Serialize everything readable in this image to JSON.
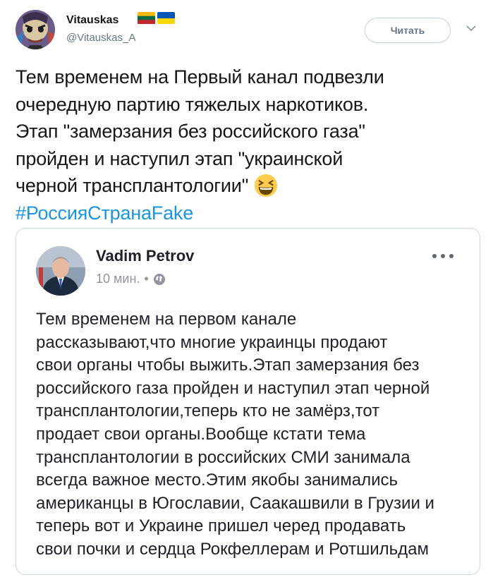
{
  "tweet": {
    "author_name": "Vitauskas",
    "handle": "@Vitauskas_A",
    "follow_label": "Читать",
    "text_lines": [
      "Тем временем на Первый канал подвезли",
      "очередную партию тяжелых наркотиков.",
      "Этап \"замерзания без российского газа\"",
      "пройден и наступил этап \"украинской",
      "черной трансплантологии\""
    ],
    "hashtag": "#РоссияСтранаFake",
    "icons": {
      "avatar": "avatar-image",
      "flags": [
        "lithuania-flag-icon",
        "ukraine-flag-icon"
      ],
      "menu": "chevron-down-icon",
      "emoji": "laughing-face-emoji-icon"
    }
  },
  "embedded_post": {
    "author_name": "Vadim Petrov",
    "time": "10 мин.",
    "dot": "•",
    "text_lines": [
      "Тем временем на первом канале",
      "рассказывают,что многие украинцы продают",
      "свои органы чтобы выжить.Этап замерзания без",
      "российского газа пройден и наступил этап черной",
      "трансплантологии,теперь кто не замёрз,тот",
      "продает свои органы.Вообще кстати тема",
      "трансплантологии в российских СМИ занимала",
      "всегда важное место.Этим якобы занимались",
      "американцы в Югославии, Саакашвили в Грузии и",
      "теперь вот и Украине пришел черед продавать",
      "свои почки и сердца Рокфеллерам и Ротшильдам"
    ],
    "icons": {
      "avatar": "avatar-image",
      "privacy": "globe-icon",
      "more": "more-options-icon"
    }
  },
  "colors": {
    "link": "#1b95e0",
    "secondary_text": "#657786",
    "border": "#ccd6dd"
  }
}
